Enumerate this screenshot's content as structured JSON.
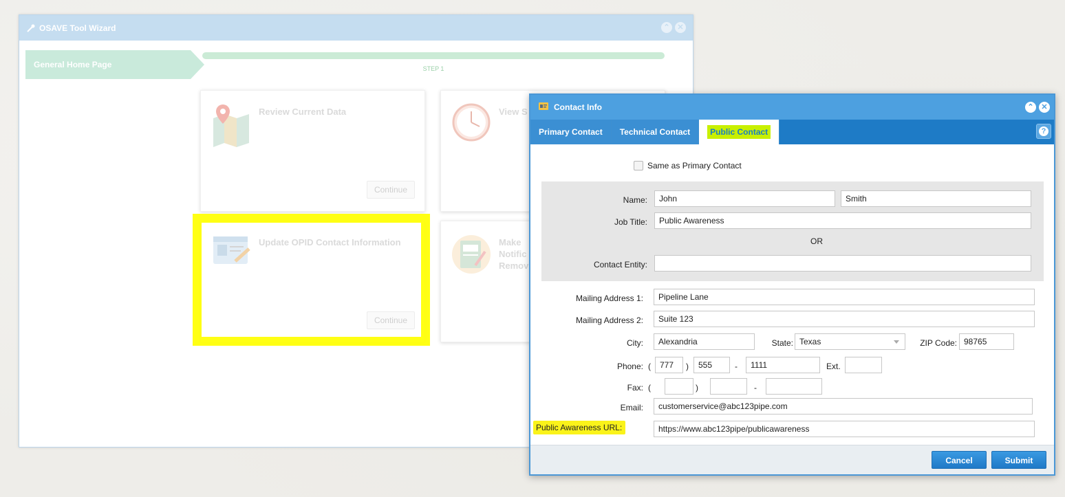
{
  "wizard": {
    "title": "OSAVE Tool Wizard",
    "step_arrow": "General Home Page",
    "step_label": "STEP 1",
    "cards": [
      {
        "title": "Review Current Data",
        "button": "Continue"
      },
      {
        "title": "View S",
        "button": ""
      },
      {
        "title": "Update OPID Contact Information",
        "button": "Continue"
      },
      {
        "title": "Make Notific Remov",
        "button": ""
      }
    ]
  },
  "dialog": {
    "title": "Contact Info",
    "tabs": [
      "Primary Contact",
      "Technical Contact",
      "Public Contact"
    ],
    "active_tab": "Public Contact",
    "same_as_primary": "Same as Primary Contact",
    "labels": {
      "name": "Name:",
      "job_title": "Job Title:",
      "or": "OR",
      "contact_entity": "Contact Entity:",
      "mailing1": "Mailing Address 1:",
      "mailing2": "Mailing Address 2:",
      "city": "City:",
      "state": "State:",
      "zip": "ZIP Code:",
      "phone": "Phone:",
      "ext": "Ext.",
      "fax": "Fax:",
      "email": "Email:",
      "url": "Public Awareness URL:"
    },
    "values": {
      "first_name": "John",
      "last_name": "Smith",
      "job_title": "Public Awareness",
      "contact_entity": "",
      "mailing1": "Pipeline Lane",
      "mailing2": "Suite 123",
      "city": "Alexandria",
      "state": "Texas",
      "zip": "98765",
      "phone_area": "777",
      "phone_prefix": "555",
      "phone_line": "1111",
      "phone_ext": "",
      "fax_area": "",
      "fax_prefix": "",
      "fax_line": "",
      "email": "customerservice@abc123pipe.com",
      "url": "https://www.abc123pipe/publicawareness"
    },
    "punct": {
      "open": "(",
      "close": ")",
      "dash": "-"
    },
    "buttons": {
      "cancel": "Cancel",
      "submit": "Submit"
    }
  },
  "colors": {
    "highlight": "#ffff00",
    "dialog_blue": "#4da0e0",
    "tab_bar": "#1e7bc6",
    "step_green": "#c9eadb"
  }
}
